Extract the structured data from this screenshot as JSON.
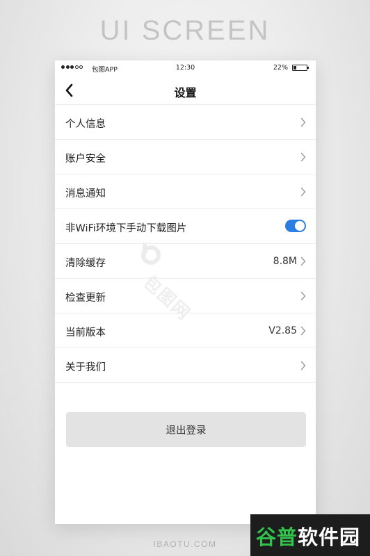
{
  "heading": "UI SCREEN",
  "status_bar": {
    "carrier": "包图APP",
    "time": "12:30",
    "battery": "22%",
    "battery_level": 0.22
  },
  "nav": {
    "title": "设置",
    "back_icon": "chevron-left-icon"
  },
  "settings": [
    {
      "label": "个人信息",
      "value": "",
      "control": "chevron"
    },
    {
      "label": "账户安全",
      "value": "",
      "control": "chevron"
    },
    {
      "label": "消息通知",
      "value": "",
      "control": "chevron"
    },
    {
      "label": "非WiFi环境下手动下载图片",
      "value": "",
      "control": "toggle",
      "toggle_on": true
    },
    {
      "label": "清除缓存",
      "value": "8.8M",
      "control": "chevron"
    },
    {
      "label": "检查更新",
      "value": "",
      "control": "chevron"
    },
    {
      "label": "当前版本",
      "value": "V2.85",
      "control": "chevron"
    },
    {
      "label": "关于我们",
      "value": "",
      "control": "chevron"
    }
  ],
  "logout_label": "退出登录",
  "watermark": "包图网",
  "footer_site": "IBAOTU.COM",
  "corner_badge": {
    "green_part": "谷普",
    "white_part": "软件园"
  },
  "colors": {
    "accent": "#2b7de2",
    "button_bg": "#e3e3e3",
    "heading": "#c4c4c4",
    "badge_green": "#32c24d"
  }
}
